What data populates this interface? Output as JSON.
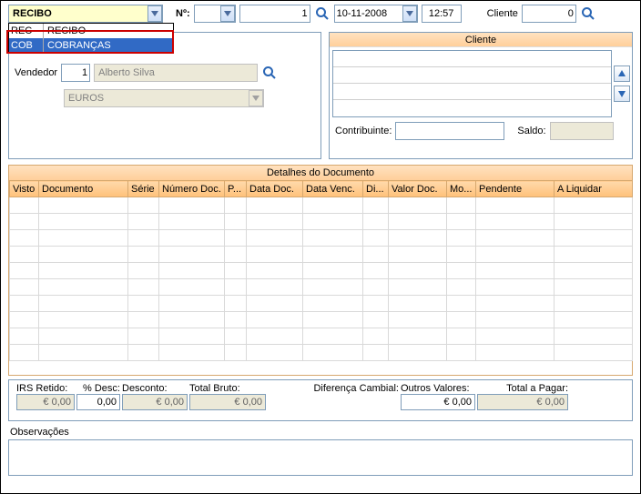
{
  "toolbar": {
    "doc_type": "RECIBO",
    "num_label": "Nº:",
    "num_series": "",
    "num_value": "1",
    "date": "10-11-2008",
    "time": "12:57",
    "cliente_label": "Cliente",
    "cliente_code": "0"
  },
  "dropdown": {
    "items": [
      {
        "code": "REC",
        "label": "RECIBO",
        "selected": false
      },
      {
        "code": "COB",
        "label": "COBRANÇAS",
        "selected": true
      }
    ]
  },
  "tipo_panel": {
    "vendedor_label": "Vendedor",
    "vendedor_code": "1",
    "vendedor_name": "Alberto Silva",
    "moeda": "EUROS"
  },
  "cliente_panel": {
    "title": "Cliente",
    "contribuinte_label": "Contribuinte:",
    "contribuinte_value": "",
    "saldo_label": "Saldo:",
    "saldo_value": ""
  },
  "details": {
    "title": "Detalhes do Documento",
    "columns": [
      "Visto",
      "Documento",
      "Série",
      "Número Doc.",
      "P...",
      "Data Doc.",
      "Data Venc.",
      "Di...",
      "Valor Doc.",
      "Mo...",
      "Pendente",
      "A Liquidar"
    ]
  },
  "totals": {
    "irs_label": "IRS Retido:",
    "irs_value": "€ 0,00",
    "pct_label": "% Desc:",
    "pct_value": "0,00",
    "desc_label": "Desconto:",
    "desc_value": "€ 0,00",
    "bruto_label": "Total Bruto:",
    "bruto_value": "€ 0,00",
    "dif_label": "Diferença Cambial:",
    "outros_label": "Outros Valores:",
    "outros_value": "€ 0,00",
    "total_label": "Total a Pagar:",
    "total_value": "€ 0,00"
  },
  "obs": {
    "label": "Observações"
  },
  "colors": {
    "highlight_yellow": "#ffffcc",
    "selection_blue": "#316ac5",
    "header_orange": "#ffcf9a"
  }
}
